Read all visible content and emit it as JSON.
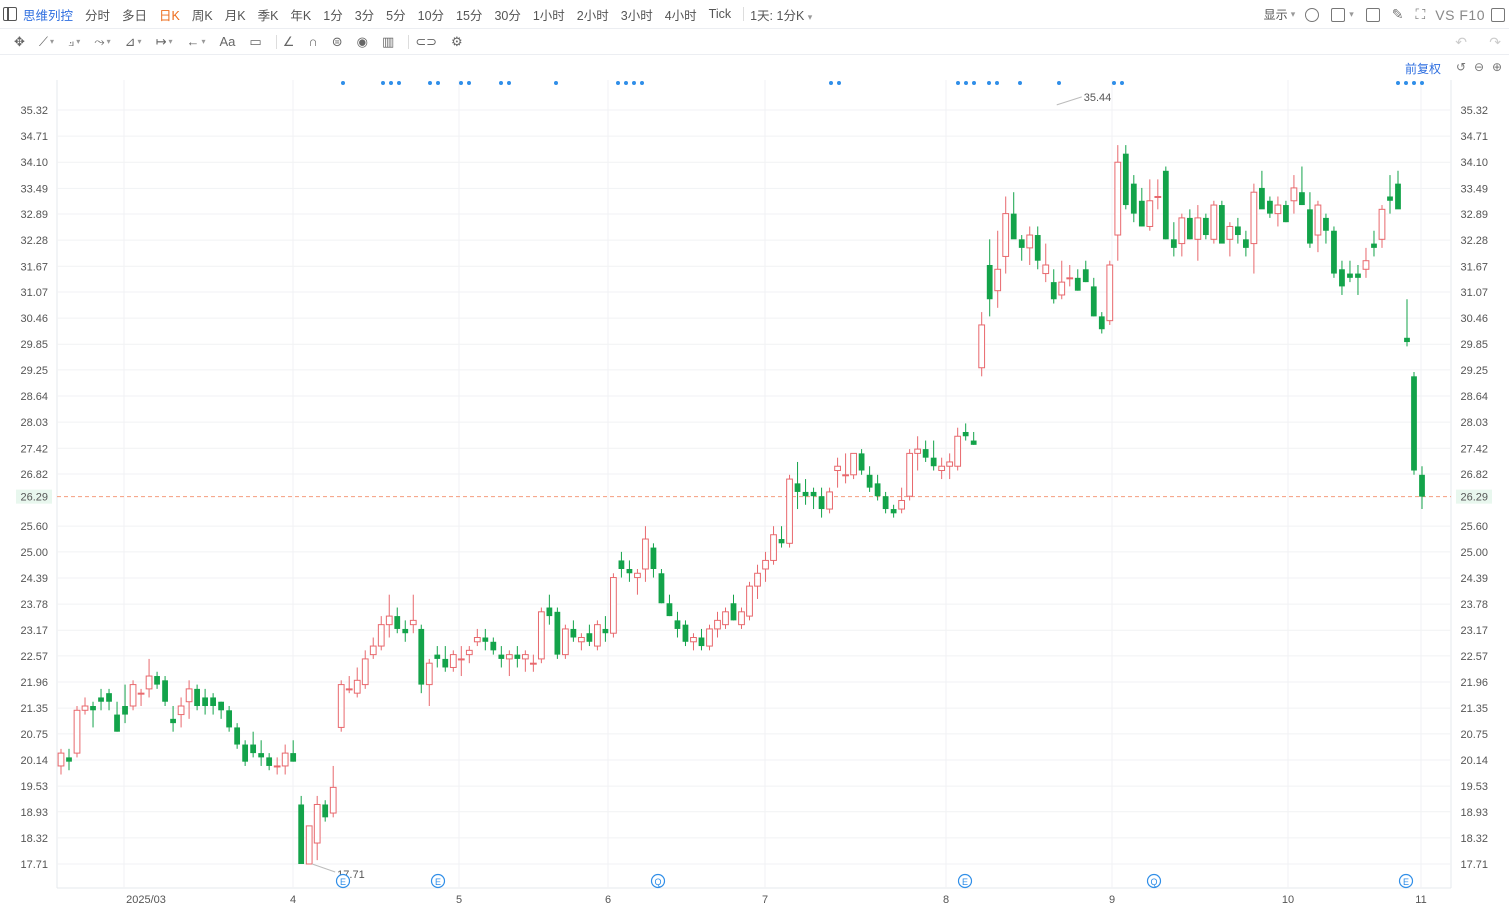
{
  "toolbar": {
    "brand": "思维列控",
    "timeframes": [
      "分时",
      "多日",
      "日K",
      "周K",
      "月K",
      "季K",
      "年K",
      "1分",
      "3分",
      "5分",
      "10分",
      "15分",
      "30分",
      "1小时",
      "2小时",
      "3小时",
      "4小时",
      "Tick",
      "1天: 1分K"
    ],
    "active_timeframe": "日K",
    "display_label": "显示",
    "vs_f10": "VS F10"
  },
  "drawing_tools": [
    "crosshair-icon",
    "line-icon",
    "polyline-icon",
    "path-icon",
    "measure-icon",
    "range-icon",
    "arrow-icon",
    "text-icon",
    "note-icon",
    "angle-icon",
    "magnet-icon",
    "eraser-icon",
    "eye-icon",
    "trash-icon",
    "link-icon",
    "settings-icon"
  ],
  "text_tool_label": "Aa",
  "adjust_label": "前复权",
  "chart_data": {
    "type": "candlestick",
    "up_color": "#e8686d",
    "down_color": "#13a34a",
    "price_ticks": [
      35.32,
      34.71,
      34.1,
      33.49,
      32.89,
      32.28,
      31.67,
      31.07,
      30.46,
      29.85,
      29.25,
      28.64,
      28.03,
      27.42,
      26.82,
      26.29,
      25.6,
      25.0,
      24.39,
      23.78,
      23.17,
      22.57,
      21.96,
      21.35,
      20.75,
      20.14,
      19.53,
      18.93,
      18.32,
      17.71
    ],
    "current_price": 26.29,
    "high_marker": "35.44",
    "low_marker": "17.71",
    "x_labels": [
      "2025/03",
      "4",
      "5",
      "6",
      "7",
      "8",
      "9",
      "10",
      "11"
    ],
    "event_markers": [
      "E",
      "E",
      "Q",
      "E",
      "Q",
      "E"
    ],
    "candles": [
      [
        20.0,
        20.4,
        19.8,
        20.3
      ],
      [
        20.2,
        20.4,
        19.9,
        20.1
      ],
      [
        20.3,
        21.4,
        20.2,
        21.3
      ],
      [
        21.3,
        21.6,
        21.2,
        21.4
      ],
      [
        21.4,
        21.5,
        20.9,
        21.3
      ],
      [
        21.6,
        21.8,
        21.3,
        21.5
      ],
      [
        21.7,
        21.8,
        21.3,
        21.5
      ],
      [
        21.2,
        21.5,
        20.8,
        20.8
      ],
      [
        21.4,
        21.9,
        21.0,
        21.2
      ],
      [
        21.4,
        22.0,
        21.3,
        21.9
      ],
      [
        21.7,
        21.8,
        21.4,
        21.7
      ],
      [
        21.8,
        22.5,
        21.6,
        22.1
      ],
      [
        22.1,
        22.2,
        21.8,
        21.9
      ],
      [
        22.0,
        22.1,
        21.4,
        21.5
      ],
      [
        21.1,
        21.4,
        20.8,
        21.0
      ],
      [
        21.2,
        21.6,
        20.9,
        21.4
      ],
      [
        21.5,
        22.0,
        21.1,
        21.8
      ],
      [
        21.8,
        21.9,
        21.3,
        21.4
      ],
      [
        21.6,
        21.8,
        21.2,
        21.4
      ],
      [
        21.6,
        21.7,
        21.2,
        21.4
      ],
      [
        21.5,
        21.5,
        21.1,
        21.3
      ],
      [
        21.3,
        21.4,
        20.8,
        20.9
      ],
      [
        20.9,
        21.0,
        20.4,
        20.5
      ],
      [
        20.5,
        20.6,
        20.0,
        20.1
      ],
      [
        20.5,
        20.8,
        20.2,
        20.3
      ],
      [
        20.3,
        20.6,
        20.0,
        20.2
      ],
      [
        20.2,
        20.3,
        19.9,
        20.0
      ],
      [
        20.0,
        20.2,
        19.8,
        20.0
      ],
      [
        20.0,
        20.5,
        19.8,
        20.3
      ],
      [
        20.3,
        20.6,
        20.1,
        20.1
      ],
      [
        19.1,
        19.3,
        17.71,
        17.71
      ],
      [
        17.71,
        18.6,
        17.71,
        18.6
      ],
      [
        18.2,
        19.3,
        17.8,
        19.1
      ],
      [
        19.1,
        19.2,
        18.7,
        18.8
      ],
      [
        18.9,
        20.0,
        18.8,
        19.5
      ],
      [
        20.9,
        22.0,
        20.8,
        21.9
      ],
      [
        21.8,
        22.1,
        21.7,
        21.8
      ],
      [
        21.7,
        22.3,
        21.6,
        22.0
      ],
      [
        21.9,
        22.7,
        21.8,
        22.5
      ],
      [
        22.6,
        23.0,
        22.5,
        22.8
      ],
      [
        22.8,
        23.5,
        22.7,
        23.3
      ],
      [
        23.3,
        24.0,
        23.0,
        23.5
      ],
      [
        23.5,
        23.7,
        23.1,
        23.2
      ],
      [
        23.2,
        23.4,
        22.9,
        23.1
      ],
      [
        23.3,
        24.0,
        23.1,
        23.4
      ],
      [
        23.2,
        23.3,
        21.7,
        21.9
      ],
      [
        21.9,
        22.5,
        21.4,
        22.4
      ],
      [
        22.6,
        22.8,
        22.3,
        22.5
      ],
      [
        22.5,
        22.8,
        22.2,
        22.3
      ],
      [
        22.3,
        22.7,
        22.2,
        22.6
      ],
      [
        22.5,
        22.8,
        22.1,
        22.5
      ],
      [
        22.6,
        22.8,
        22.4,
        22.7
      ],
      [
        22.9,
        23.2,
        22.8,
        23.0
      ],
      [
        23.0,
        23.2,
        22.7,
        22.9
      ],
      [
        22.9,
        23.0,
        22.6,
        22.7
      ],
      [
        22.6,
        22.8,
        22.3,
        22.5
      ],
      [
        22.5,
        22.7,
        22.1,
        22.6
      ],
      [
        22.6,
        22.8,
        22.3,
        22.5
      ],
      [
        22.5,
        22.7,
        22.2,
        22.6
      ],
      [
        22.4,
        22.6,
        22.2,
        22.4
      ],
      [
        22.5,
        23.7,
        22.4,
        23.6
      ],
      [
        23.7,
        24.0,
        23.3,
        23.5
      ],
      [
        23.6,
        23.7,
        22.5,
        22.6
      ],
      [
        22.6,
        23.3,
        22.5,
        23.2
      ],
      [
        23.2,
        23.4,
        22.9,
        23.0
      ],
      [
        22.9,
        23.1,
        22.7,
        23.0
      ],
      [
        23.1,
        23.3,
        22.8,
        22.9
      ],
      [
        22.8,
        23.4,
        22.7,
        23.3
      ],
      [
        23.2,
        23.5,
        22.9,
        23.1
      ],
      [
        23.1,
        24.5,
        23.0,
        24.4
      ],
      [
        24.8,
        25.0,
        24.4,
        24.6
      ],
      [
        24.6,
        24.8,
        24.3,
        24.5
      ],
      [
        24.4,
        24.6,
        24.0,
        24.5
      ],
      [
        24.6,
        25.6,
        24.3,
        25.3
      ],
      [
        25.1,
        25.2,
        24.4,
        24.6
      ],
      [
        24.5,
        24.6,
        23.8,
        23.8
      ],
      [
        23.8,
        24.0,
        23.5,
        23.5
      ],
      [
        23.4,
        23.6,
        23.0,
        23.2
      ],
      [
        23.3,
        23.4,
        22.8,
        22.9
      ],
      [
        22.9,
        23.1,
        22.7,
        23.0
      ],
      [
        23.0,
        23.2,
        22.7,
        22.8
      ],
      [
        22.8,
        23.3,
        22.7,
        23.2
      ],
      [
        23.2,
        23.6,
        23.0,
        23.4
      ],
      [
        23.3,
        23.7,
        23.2,
        23.6
      ],
      [
        23.8,
        24.0,
        23.4,
        23.4
      ],
      [
        23.3,
        23.7,
        23.2,
        23.6
      ],
      [
        23.5,
        24.3,
        23.4,
        24.2
      ],
      [
        24.2,
        24.7,
        23.9,
        24.5
      ],
      [
        24.6,
        25.0,
        24.3,
        24.8
      ],
      [
        24.8,
        25.6,
        24.7,
        25.4
      ],
      [
        25.3,
        25.6,
        25.1,
        25.2
      ],
      [
        25.2,
        26.8,
        25.1,
        26.7
      ],
      [
        26.6,
        27.1,
        26.0,
        26.4
      ],
      [
        26.4,
        26.7,
        26.1,
        26.3
      ],
      [
        26.4,
        26.5,
        26.0,
        26.3
      ],
      [
        26.3,
        26.5,
        25.8,
        26.0
      ],
      [
        26.0,
        26.5,
        25.9,
        26.4
      ],
      [
        26.9,
        27.2,
        26.5,
        27.0
      ],
      [
        26.8,
        27.3,
        26.6,
        26.8
      ],
      [
        26.8,
        27.3,
        26.7,
        27.3
      ],
      [
        27.3,
        27.4,
        26.8,
        26.9
      ],
      [
        26.8,
        27.0,
        26.4,
        26.5
      ],
      [
        26.6,
        26.8,
        26.2,
        26.3
      ],
      [
        26.3,
        26.4,
        25.9,
        26.0
      ],
      [
        26.0,
        26.1,
        25.8,
        25.9
      ],
      [
        26.0,
        26.5,
        25.9,
        26.2
      ],
      [
        26.3,
        27.4,
        26.2,
        27.3
      ],
      [
        27.3,
        27.7,
        26.9,
        27.4
      ],
      [
        27.4,
        27.6,
        27.1,
        27.2
      ],
      [
        27.2,
        27.6,
        26.9,
        27.0
      ],
      [
        26.9,
        27.2,
        26.7,
        27.0
      ],
      [
        27.0,
        27.3,
        26.7,
        27.1
      ],
      [
        27.0,
        27.9,
        26.9,
        27.7
      ],
      [
        27.8,
        28.0,
        27.6,
        27.7
      ],
      [
        27.6,
        27.8,
        27.5,
        27.5
      ],
      [
        29.3,
        30.6,
        29.1,
        30.3
      ],
      [
        31.7,
        32.3,
        30.5,
        30.9
      ],
      [
        31.1,
        32.5,
        30.7,
        31.6
      ],
      [
        31.9,
        33.3,
        31.5,
        32.9
      ],
      [
        32.9,
        33.4,
        32.6,
        32.3
      ],
      [
        32.3,
        32.4,
        31.8,
        32.1
      ],
      [
        32.1,
        32.6,
        31.7,
        32.4
      ],
      [
        32.4,
        32.6,
        31.6,
        31.8
      ],
      [
        31.5,
        32.2,
        31.3,
        31.7
      ],
      [
        31.3,
        31.6,
        30.8,
        30.9
      ],
      [
        31.0,
        31.8,
        30.9,
        31.3
      ],
      [
        31.4,
        31.7,
        31.2,
        31.4
      ],
      [
        31.4,
        31.6,
        31.1,
        31.1
      ],
      [
        31.6,
        31.8,
        31.3,
        31.3
      ],
      [
        31.2,
        31.4,
        30.5,
        30.5
      ],
      [
        30.5,
        30.6,
        30.1,
        30.2
      ],
      [
        30.4,
        31.8,
        30.3,
        31.7
      ],
      [
        32.4,
        34.5,
        31.8,
        34.1
      ],
      [
        34.3,
        34.5,
        33.0,
        33.1
      ],
      [
        33.6,
        33.8,
        32.7,
        32.9
      ],
      [
        33.2,
        33.5,
        32.6,
        32.6
      ],
      [
        32.6,
        33.7,
        32.5,
        33.2
      ],
      [
        33.3,
        33.7,
        33.0,
        33.3
      ],
      [
        33.9,
        34.0,
        32.3,
        32.3
      ],
      [
        32.3,
        32.7,
        31.9,
        32.1
      ],
      [
        32.2,
        32.9,
        31.9,
        32.8
      ],
      [
        32.8,
        33.0,
        32.3,
        32.3
      ],
      [
        32.3,
        33.1,
        31.8,
        32.8
      ],
      [
        32.8,
        32.9,
        32.3,
        32.4
      ],
      [
        32.3,
        33.2,
        32.2,
        33.1
      ],
      [
        33.1,
        33.2,
        32.3,
        32.2
      ],
      [
        32.3,
        32.7,
        31.9,
        32.6
      ],
      [
        32.6,
        32.8,
        32.2,
        32.4
      ],
      [
        32.3,
        32.5,
        31.9,
        32.1
      ],
      [
        32.2,
        33.6,
        31.5,
        33.4
      ],
      [
        33.5,
        33.9,
        33.1,
        33.0
      ],
      [
        33.2,
        33.3,
        32.8,
        32.9
      ],
      [
        32.9,
        33.3,
        32.6,
        33.1
      ],
      [
        33.1,
        33.2,
        32.7,
        32.7
      ],
      [
        33.2,
        33.8,
        32.9,
        33.5
      ],
      [
        33.4,
        34.0,
        33.1,
        33.1
      ],
      [
        33.0,
        33.4,
        32.1,
        32.2
      ],
      [
        32.4,
        33.2,
        32.0,
        33.1
      ],
      [
        32.8,
        32.9,
        32.2,
        32.5
      ],
      [
        32.5,
        32.6,
        31.4,
        31.5
      ],
      [
        31.6,
        31.8,
        31.0,
        31.2
      ],
      [
        31.5,
        31.8,
        31.3,
        31.4
      ],
      [
        31.5,
        31.7,
        31.0,
        31.4
      ],
      [
        31.6,
        32.1,
        31.4,
        31.8
      ],
      [
        32.2,
        32.5,
        31.9,
        32.1
      ],
      [
        32.3,
        33.1,
        32.1,
        33.0
      ],
      [
        33.3,
        33.8,
        32.9,
        33.2
      ],
      [
        33.6,
        33.9,
        33.1,
        33.0
      ]
    ],
    "gap_candles": [
      [
        30.0,
        30.9,
        29.8,
        29.9
      ],
      [
        29.1,
        29.2,
        26.8,
        26.9
      ],
      [
        26.8,
        27.0,
        26.0,
        26.29
      ]
    ]
  }
}
